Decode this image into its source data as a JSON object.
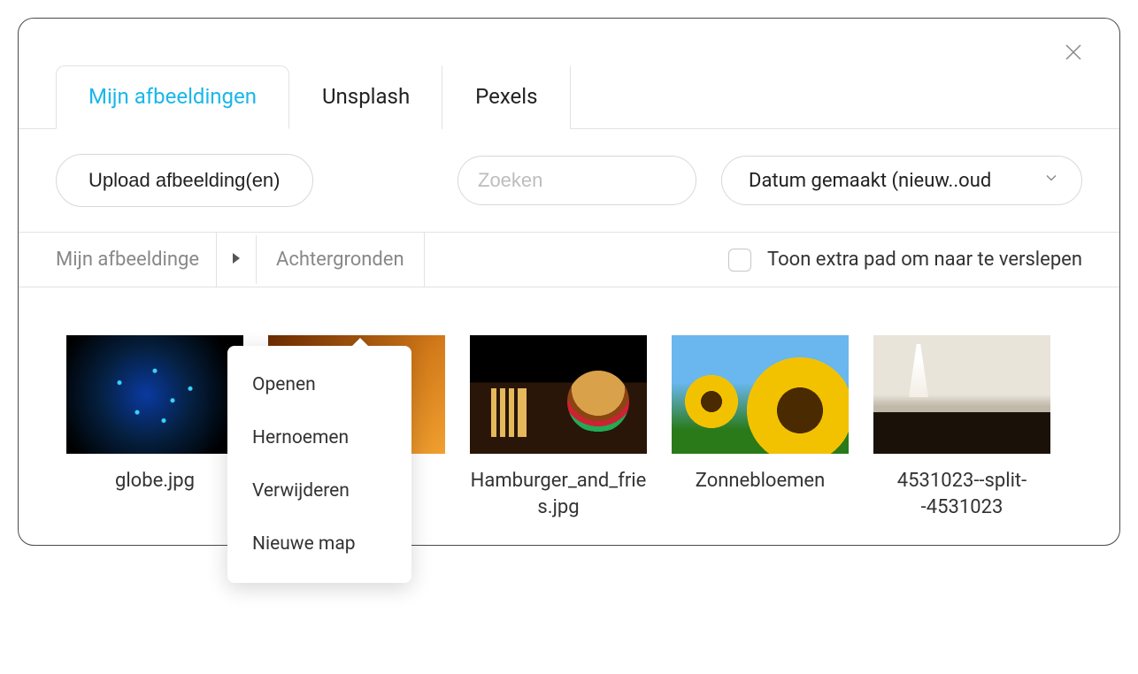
{
  "tabs": [
    {
      "label": "Mijn afbeeldingen",
      "active": true
    },
    {
      "label": "Unsplash",
      "active": false
    },
    {
      "label": "Pexels",
      "active": false
    }
  ],
  "toolbar": {
    "upload_label": "Upload afbeelding(en)",
    "search_placeholder": "Zoeken",
    "sort_label": "Datum gemaakt (nieuw..oud"
  },
  "breadcrumb": {
    "root": "Mijn afbeeldinge",
    "current": "Achtergronden"
  },
  "drag_toggle": {
    "label": "Toon extra pad om naar te verslepen",
    "checked": false
  },
  "context_menu": {
    "items": [
      "Openen",
      "Hernoemen",
      "Verwijderen",
      "Nieuwe map"
    ]
  },
  "thumbnails": [
    {
      "label": "globe.jpg",
      "art": "globe"
    },
    {
      "label": "",
      "art": "pizza"
    },
    {
      "label": "Hamburger_and_fries.jpg",
      "art": "burger"
    },
    {
      "label": "Zonnebloemen",
      "art": "sunflower"
    },
    {
      "label": "4531023--split--4531023",
      "art": "bride"
    }
  ]
}
